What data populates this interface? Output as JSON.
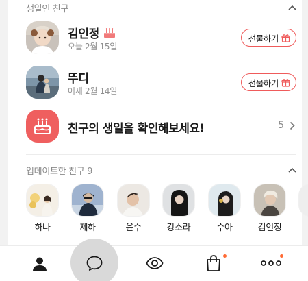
{
  "birthday_section": {
    "title": "생일인 친구",
    "friends": [
      {
        "name": "김인정",
        "date": "오늘 2월 15일",
        "gift_label": "선물하기",
        "has_cake": true
      },
      {
        "name": "뚜디",
        "date": "어제 2월 14일",
        "gift_label": "선물하기",
        "has_cake": false
      }
    ],
    "check_label": "친구의 생일을 확인해보세요!",
    "check_count": "5"
  },
  "updated_section": {
    "title": "업데이트한 친구 9",
    "friends": [
      {
        "name": "하나"
      },
      {
        "name": "제하"
      },
      {
        "name": "윤수"
      },
      {
        "name": "강소라"
      },
      {
        "name": "수아"
      },
      {
        "name": "김인정"
      }
    ]
  },
  "tabbar": {
    "items": [
      {
        "icon": "person-icon",
        "active": true
      },
      {
        "icon": "chat-bubble-icon",
        "active": false
      },
      {
        "icon": "eye-view-icon",
        "active": false
      },
      {
        "icon": "shopping-bag-icon",
        "active": false,
        "badge": true
      },
      {
        "icon": "more-dots-icon",
        "active": false,
        "badge": true
      }
    ]
  },
  "colors": {
    "accent": "#ef5f5f",
    "badge": "#ff6b35",
    "secondary_text": "#8a8a8a"
  }
}
